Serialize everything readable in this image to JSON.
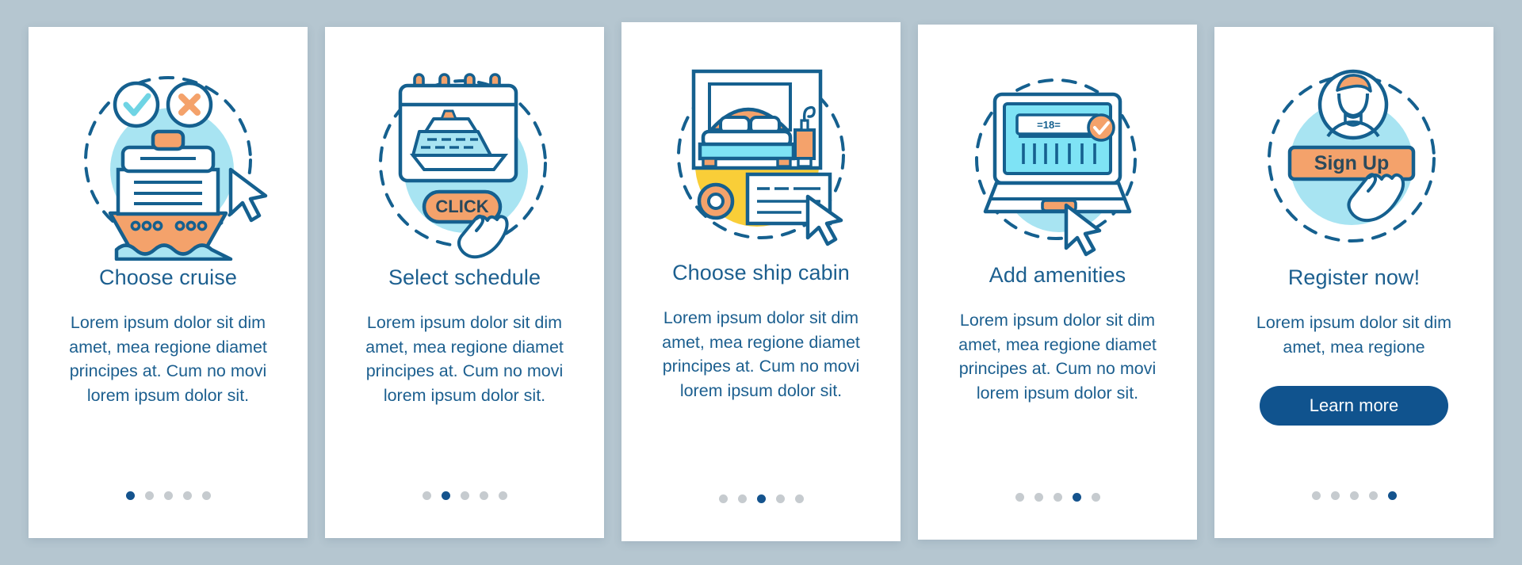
{
  "page": {
    "background_color": "#b5c6d0",
    "card_background": "#ffffff",
    "title_color": "#1c5f8f",
    "body_color": "#1c5f8f",
    "accent_orange": "#F4A26B",
    "accent_cyan": "#A8E4F2",
    "accent_yellow": "#F9CE38",
    "stroke_blue": "#15608F",
    "dot_active_color": "#14538d",
    "dot_inactive_color": "#c6cbcf",
    "total_steps": 5
  },
  "cards": [
    {
      "title": "Choose cruise",
      "body": "Lorem ipsum dolor sit dim amet, mea regione diamet principes at. Cum no movi lorem ipsum dolor sit.",
      "active_step": 1,
      "illustration": "cruise-ship-icon",
      "cta": null
    },
    {
      "title": "Select schedule",
      "body": "Lorem ipsum dolor sit dim amet, mea regione diamet principes at. Cum no movi lorem ipsum dolor sit.",
      "active_step": 2,
      "illustration": "calendar-ship-click-icon",
      "illustration_label": "CLICK",
      "cta": null
    },
    {
      "title": "Choose ship cabin",
      "body": "Lorem ipsum dolor sit dim amet, mea regione diamet principes at. Cum no movi lorem ipsum dolor sit.",
      "active_step": 3,
      "illustration": "cabin-bed-icon",
      "cta": null
    },
    {
      "title": "Add amenities",
      "body": "Lorem ipsum dolor sit dim amet, mea regione diamet principes at. Cum no movi lorem ipsum dolor sit.",
      "active_step": 4,
      "illustration": "laptop-booking-icon",
      "illustration_label": "=18=",
      "cta": null
    },
    {
      "title": "Register now!",
      "body": "Lorem ipsum dolor sit dim amet, mea regione",
      "active_step": 5,
      "illustration": "sign-up-avatar-icon",
      "illustration_label": "Sign Up",
      "cta": "Learn more"
    }
  ]
}
